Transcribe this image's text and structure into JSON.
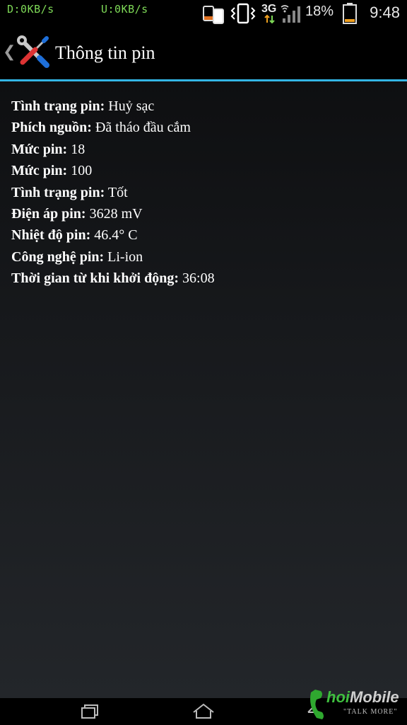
{
  "status_bar": {
    "download": "D:0KB/s",
    "upload": "U:0KB/s",
    "network_type": "3G",
    "battery_percent": "18%",
    "battery_level": 0.18,
    "time": "9:48",
    "icons": [
      "phone-switch-icon",
      "vibrate-icon",
      "data-3g-icon",
      "wifi-off-icon",
      "signal-icon",
      "battery-icon"
    ]
  },
  "action_bar": {
    "title": "Thông tin pin",
    "app_icon": "tools-icon",
    "up_icon": "back-caret-icon"
  },
  "battery_info": [
    {
      "label": "Tình trạng pin:",
      "value": "Huỷ sạc"
    },
    {
      "label": "Phích nguồn:",
      "value": "Đã tháo đầu cắm"
    },
    {
      "label": "Mức pin:",
      "value": "18"
    },
    {
      "label": "Mức pin:",
      "value": "100"
    },
    {
      "label": "Tình trạng pin:",
      "value": "Tốt"
    },
    {
      "label": "Điện áp pin:",
      "value": "3628 mV"
    },
    {
      "label": "Nhiệt độ pin:",
      "value": "46.4° C"
    },
    {
      "label": "Công nghệ pin:",
      "value": "Li-ion"
    },
    {
      "label": "Thời gian từ khi khởi động:",
      "value": "36:08"
    }
  ],
  "nav_bar": {
    "buttons": [
      "recent-apps-icon",
      "home-icon",
      "back-icon"
    ]
  },
  "watermark": {
    "brand_a": "hoi",
    "brand_b": "Mobile",
    "tagline": "\"TALK MORE\""
  },
  "colors": {
    "accent": "#33b5e5",
    "net_speed": "#7ed957",
    "battery_fill": "#f0a020"
  }
}
